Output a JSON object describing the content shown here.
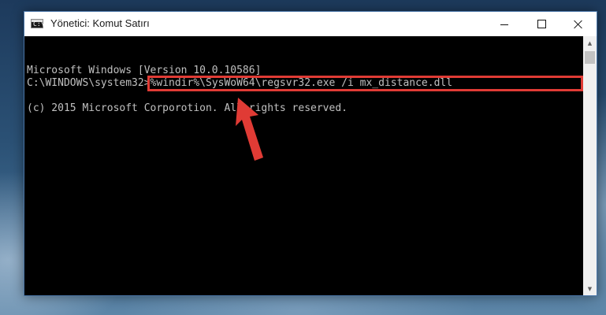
{
  "window": {
    "title": "Yönetici: Komut Satırı",
    "icon_label": "C:\\",
    "controls": {
      "minimize": "minimize-icon",
      "maximize": "maximize-icon",
      "close": "close-icon"
    }
  },
  "console": {
    "lines": [
      "Microsoft Windows [Version 10.0.10586]",
      "(c) 2015 Microsoft Corporotion. All rights reserved."
    ],
    "prompt": "C:\\WINDOWS\\system32>",
    "command": "%windir%\\SysWoW64\\regsvr32.exe /i mx_distance.dll"
  },
  "annotation": {
    "highlight_color": "#e03b35",
    "arrow_icon": "arrow-pointer-icon"
  },
  "scrollbar": {
    "up_icon": "scroll-up-icon",
    "down_icon": "scroll-down-icon"
  }
}
